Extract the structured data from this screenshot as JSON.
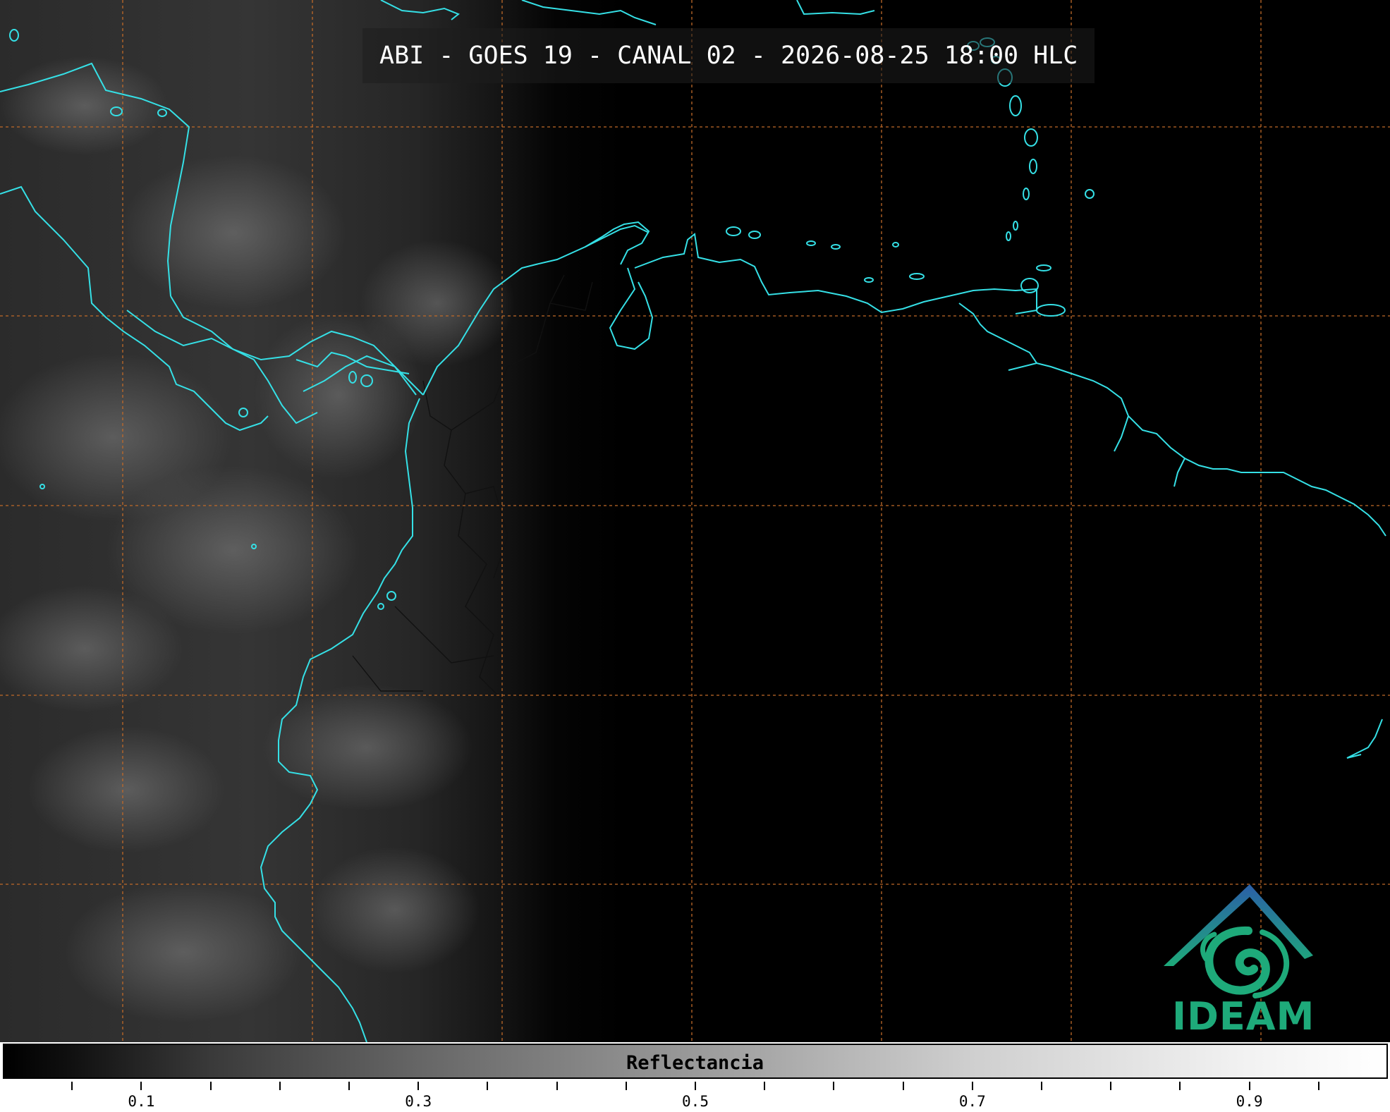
{
  "title": "ABI - GOES 19 - CANAL 02 - 2026-08-25 18:00 HLC",
  "logo": {
    "text": "IDEAM"
  },
  "colorbar": {
    "label": "Reflectancia",
    "tick_labels": [
      "0.1",
      "0.3",
      "0.5",
      "0.7",
      "0.9"
    ],
    "range": [
      0.0,
      1.0
    ]
  },
  "colors": {
    "coastline": "#35e0e6",
    "grid": "#c06a28",
    "borders": "#111111",
    "logo_blue": "#2b5fa8",
    "logo_green": "#1eaa7a"
  }
}
